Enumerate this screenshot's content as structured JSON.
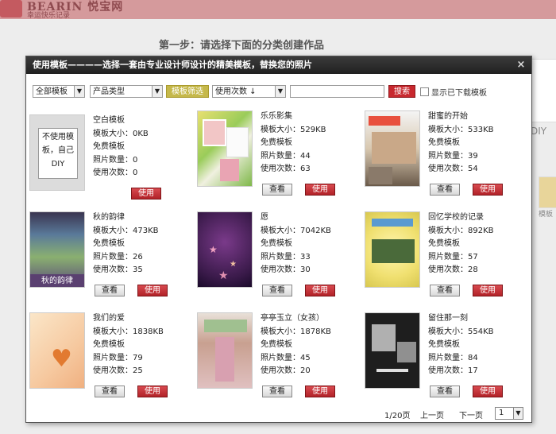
{
  "header": {
    "logo_text": "BEARIN 悦宝网",
    "logo_sub": "幸运快乐记录"
  },
  "step_title": "第一步：请选择下面的分类创建作品",
  "background": {
    "diy_text": "DIY",
    "side_text": "模板"
  },
  "modal": {
    "title": "使用模板————选择一套由专业设计师设计的精美模板，替换您的照片",
    "close_symbol": "×"
  },
  "toolbar": {
    "all_templates": "全部模板",
    "product_type": "产品类型",
    "filter_button": "模板筛选",
    "sort_label": "使用次数 ↓",
    "search_value": "",
    "search_button": "搜索",
    "show_downloaded": "显示已下载模板"
  },
  "templates": [
    {
      "name": "空白模板",
      "size": "模板大小：0KB",
      "type": "免费模板",
      "photos": "照片数量：0",
      "uses": "使用次数：0",
      "thumb_text": "不使用模板，自己DIY",
      "view": "",
      "use": "使用"
    },
    {
      "name": "乐乐影集",
      "size": "模板大小：529KB",
      "type": "免费模板",
      "photos": "照片数量：44",
      "uses": "使用次数：63",
      "thumb_text": "",
      "view": "查看",
      "use": "使用"
    },
    {
      "name": "甜蜜的开始",
      "size": "模板大小：533KB",
      "type": "免费模板",
      "photos": "照片数量：39",
      "uses": "使用次数：54",
      "thumb_text": "",
      "view": "查看",
      "use": "使用"
    },
    {
      "name": "秋的韵律",
      "size": "模板大小：473KB",
      "type": "免费模板",
      "photos": "照片数量：26",
      "uses": "使用次数：35",
      "thumb_text": "秋的韵律",
      "view": "查看",
      "use": "使用"
    },
    {
      "name": "愿",
      "size": "模板大小：7042KB",
      "type": "免费模板",
      "photos": "照片数量：33",
      "uses": "使用次数：30",
      "thumb_text": "",
      "view": "查看",
      "use": "使用"
    },
    {
      "name": "回忆学校的记录",
      "size": "模板大小：892KB",
      "type": "免费模板",
      "photos": "照片数量：57",
      "uses": "使用次数：28",
      "thumb_text": "",
      "view": "查看",
      "use": "使用"
    },
    {
      "name": "我们的爱",
      "size": "模板大小：1838KB",
      "type": "免费模板",
      "photos": "照片数量：79",
      "uses": "使用次数：25",
      "thumb_text": "",
      "view": "查看",
      "use": "使用"
    },
    {
      "name": "亭亭玉立（女孩）",
      "size": "模板大小：1878KB",
      "type": "免费模板",
      "photos": "照片数量：45",
      "uses": "使用次数：20",
      "thumb_text": "",
      "view": "查看",
      "use": "使用"
    },
    {
      "name": "留住那一刻",
      "size": "模板大小：554KB",
      "type": "免费模板",
      "photos": "照片数量：84",
      "uses": "使用次数：17",
      "thumb_text": "",
      "view": "查看",
      "use": "使用"
    }
  ],
  "pager": {
    "page_info": "1/20页",
    "prev": "上一页",
    "next": "下一页",
    "current": "1"
  }
}
